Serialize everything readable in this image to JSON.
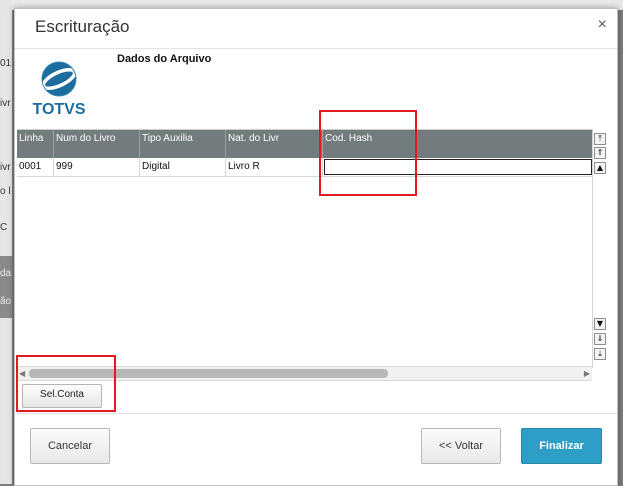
{
  "background": {
    "fragments": [
      "01",
      "ivr",
      "ivr",
      "o l",
      "C",
      "da",
      "ão"
    ]
  },
  "dialog": {
    "title": "Escrituração",
    "close": "×"
  },
  "logo": {
    "text": "TOTVS"
  },
  "section": {
    "title": "Dados do Arquivo"
  },
  "grid": {
    "columns": [
      "Linha",
      "Num do Livro",
      "Tipo Auxilia",
      "Nat. do Livr",
      "Cod. Hash"
    ],
    "rows": [
      [
        "0001",
        "999",
        "Digital",
        "Livro R",
        ""
      ]
    ]
  },
  "scroll": {
    "top_glyph": "⤒",
    "up_fast_glyph": "⇑",
    "up_glyph": "▲",
    "down_glyph": "▼",
    "down_fast_glyph": "⇓",
    "bottom_glyph": "⤓",
    "left_glyph": "◀",
    "right_glyph": "▶"
  },
  "buttons": {
    "sel_conta": "Sel.Conta",
    "cancelar": "Cancelar",
    "voltar": "<< Voltar",
    "finalizar": "Finalizar"
  },
  "colors": {
    "header_bg": "#737b7d",
    "primary": "#2d9fc7",
    "highlight": "#e01b22",
    "logo_blue": "#1d6e9e"
  }
}
